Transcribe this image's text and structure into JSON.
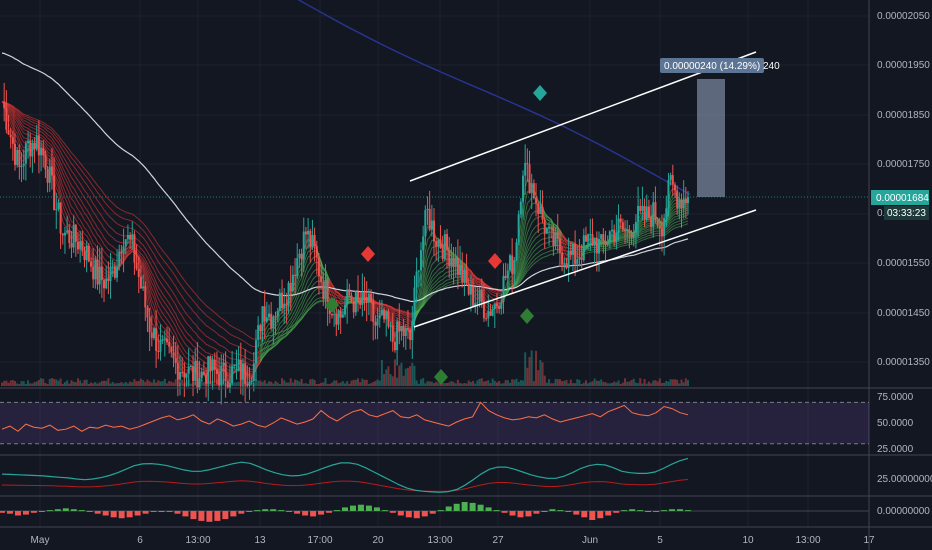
{
  "chart_data": {
    "type": "candlestick",
    "price_axis": {
      "ticks": [
        "0.00002050",
        "0.00001950",
        "0.00001850",
        "0.00001750",
        "0.00001550",
        "0.00001450",
        "0.00001350"
      ],
      "range": [
        1.3e-05,
        2.08e-05
      ],
      "last_price": "0.00001684",
      "countdown": "03:33:23"
    },
    "time_axis": {
      "ticks": [
        "May",
        "6",
        "13:00",
        "13",
        "17:00",
        "20",
        "13:00",
        "27",
        "Jun",
        "5",
        "10",
        "13:00",
        "17"
      ]
    },
    "measure_label": "0.00000240 (14.29%) 240",
    "close_series": [
      1.88e-05,
      1.81e-05,
      1.74e-05,
      1.79e-05,
      1.8e-05,
      1.76e-05,
      1.68e-05,
      1.61e-05,
      1.6e-05,
      1.59e-05,
      1.56e-05,
      1.52e-05,
      1.51e-05,
      1.54e-05,
      1.61e-05,
      1.58e-05,
      1.5e-05,
      1.42e-05,
      1.38e-05,
      1.36e-05,
      1.34e-05,
      1.33e-05,
      1.32e-05,
      1.32e-05,
      1.33e-05,
      1.32e-05,
      1.32e-05,
      1.33e-05,
      1.32e-05,
      1.34e-05,
      1.46e-05,
      1.44e-05,
      1.47e-05,
      1.5e-05,
      1.56e-05,
      1.61e-05,
      1.57e-05,
      1.5e-05,
      1.46e-05,
      1.44e-05,
      1.48e-05,
      1.46e-05,
      1.47e-05,
      1.42e-05,
      1.43e-05,
      1.39e-05,
      1.41e-05,
      1.39e-05,
      1.56e-05,
      1.65e-05,
      1.6e-05,
      1.58e-05,
      1.56e-05,
      1.52e-05,
      1.48e-05,
      1.47e-05,
      1.45e-05,
      1.47e-05,
      1.52e-05,
      1.56e-05,
      1.75e-05,
      1.71e-05,
      1.65e-05,
      1.6e-05,
      1.58e-05,
      1.56e-05,
      1.56e-05,
      1.58e-05,
      1.6e-05,
      1.58e-05,
      1.61e-05,
      1.62e-05,
      1.61e-05,
      1.64e-05,
      1.64e-05,
      1.65e-05,
      1.63e-05,
      1.71e-05,
      1.68e-05,
      1.684e-05
    ],
    "rsi": {
      "ticks": [
        "75.0000",
        "50.0000",
        "25.0000"
      ],
      "band": [
        30,
        70
      ],
      "range": [
        22,
        80
      ],
      "values": [
        44,
        47,
        42,
        49,
        46,
        45,
        48,
        43,
        44,
        47,
        42,
        46,
        45,
        48,
        46,
        47,
        44,
        46,
        49,
        52,
        55,
        57,
        53,
        55,
        58,
        52,
        49,
        54,
        51,
        47,
        49,
        52,
        48,
        46,
        50,
        55,
        52,
        49,
        51,
        54,
        62,
        56,
        52,
        57,
        61,
        63,
        58,
        56,
        59,
        62,
        56,
        55,
        58,
        53,
        51,
        49,
        47,
        51,
        54,
        56,
        70,
        62,
        58,
        55,
        53,
        54,
        56,
        55,
        58,
        54,
        51,
        53,
        55,
        57,
        59,
        56,
        61,
        64,
        67,
        60,
        58,
        57,
        60,
        66,
        64,
        60,
        58
      ]
    },
    "oscillator": {
      "ticks": [
        "25.00000000"
      ],
      "range": [
        0,
        100
      ],
      "values": [
        54,
        53,
        52,
        51,
        50,
        49,
        47,
        45,
        43,
        40,
        38,
        40,
        44,
        50,
        58,
        68,
        78,
        83,
        84,
        82,
        78,
        72,
        66,
        62,
        62,
        66,
        72,
        78,
        84,
        88,
        85,
        76,
        66,
        58,
        52,
        49,
        50,
        55,
        63,
        72,
        80,
        86,
        86,
        82,
        72,
        60,
        48,
        36,
        24,
        14,
        8,
        5,
        3,
        2,
        4,
        10,
        22,
        38,
        55,
        68,
        74,
        74,
        68,
        60,
        52,
        46,
        42,
        42,
        48,
        58,
        70,
        78,
        82,
        80,
        72,
        62,
        58,
        56,
        56,
        60,
        70,
        82,
        92,
        99
      ]
    },
    "histogram": {
      "ticks": [
        "0.00000000"
      ],
      "values": [
        -2,
        -3,
        -5,
        -4,
        -2,
        -1,
        1,
        2,
        3,
        2,
        1,
        -1,
        -3,
        -5,
        -7,
        -8,
        -7,
        -5,
        -3,
        -1,
        0,
        -1,
        -3,
        -6,
        -9,
        -11,
        -12,
        -11,
        -9,
        -6,
        -3,
        -1,
        1,
        2,
        2,
        1,
        -1,
        -3,
        -5,
        -6,
        -4,
        -2,
        1,
        4,
        6,
        7,
        6,
        4,
        1,
        -2,
        -5,
        -7,
        -8,
        -6,
        -3,
        1,
        5,
        8,
        10,
        9,
        7,
        4,
        1,
        -2,
        -5,
        -7,
        -6,
        -3,
        0,
        2,
        1,
        -1,
        -4,
        -7,
        -10,
        -8,
        -5,
        -2,
        1,
        2,
        1,
        0,
        -1,
        1,
        2,
        2,
        1
      ]
    },
    "colors": {
      "background": "#131722",
      "up": "#26a69a",
      "down": "#ef5350",
      "ribbon_red": "#e53935",
      "ribbon_green": "#4caf50",
      "ma_white": "#d1d4dc",
      "ma_blue": "#283593",
      "price_badge": "#26a69a",
      "measure_box": "#7d8ca3",
      "rsi_line": "#ff7043",
      "rsi_band": "#7e57c2",
      "histogram_up": "#4caf50",
      "histogram_down": "#ef5350"
    }
  }
}
